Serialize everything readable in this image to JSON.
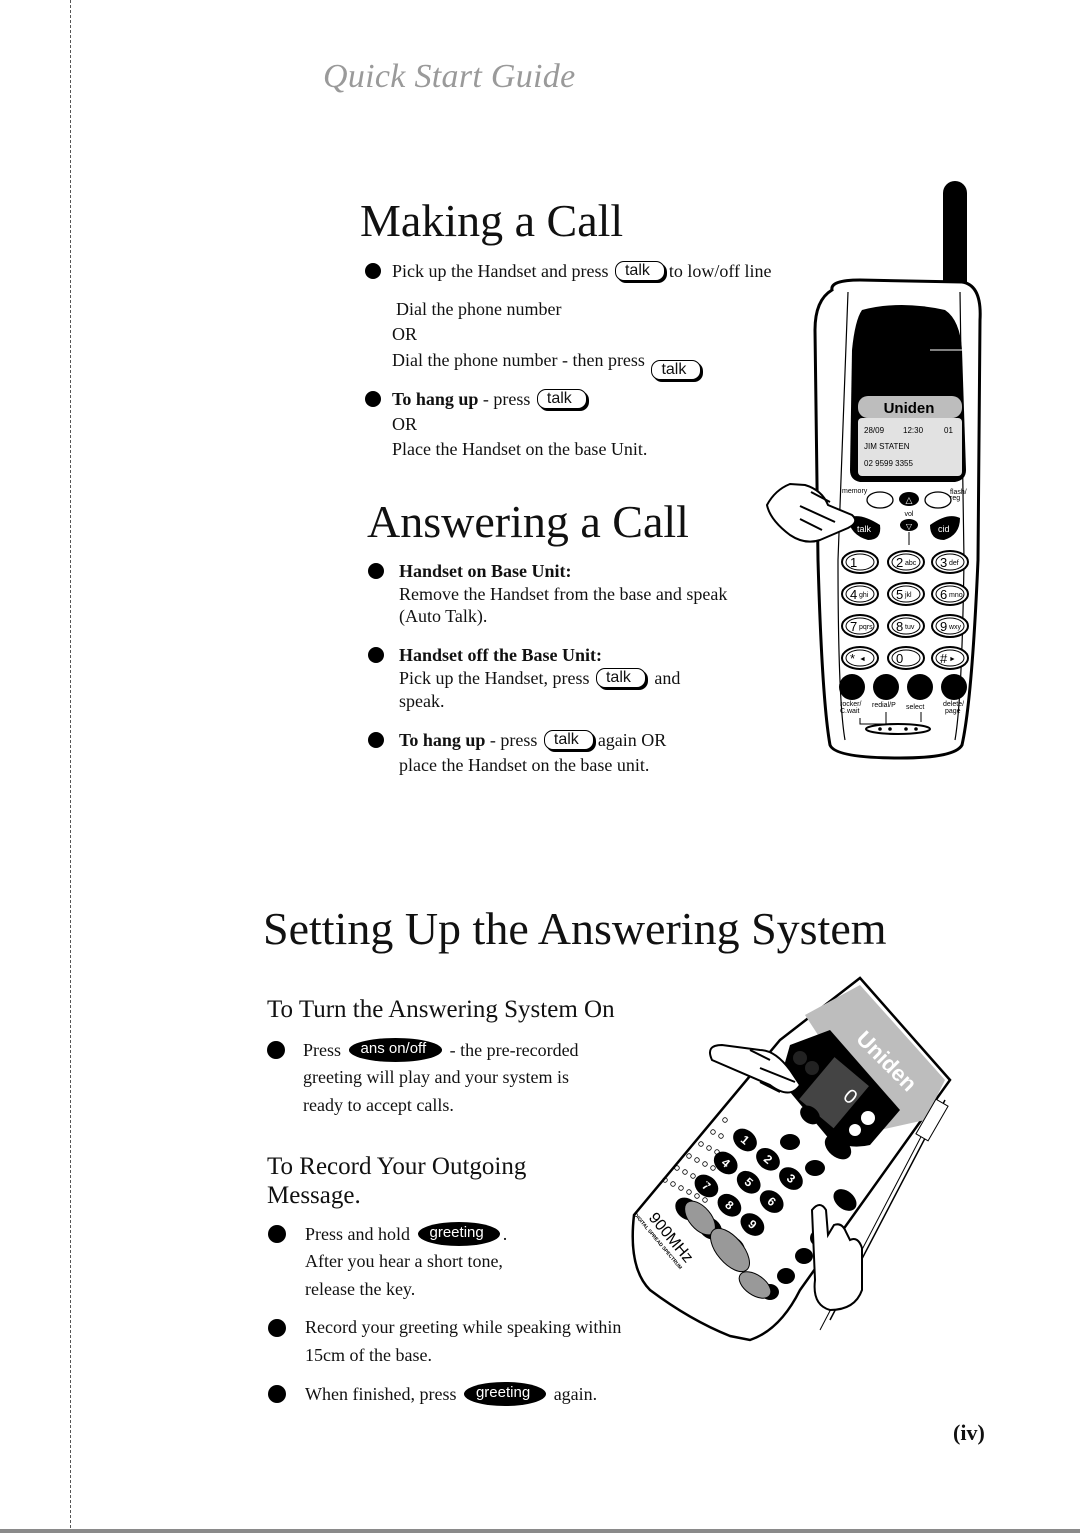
{
  "header": {
    "guide_title": "Quick Start Guide"
  },
  "making_call": {
    "title": "Making a Call",
    "step1_pre": "Pick up the Handset and press",
    "step1_post": "to low/off line",
    "dial": "Dial the phone number",
    "or1": "OR",
    "dial_then": "Dial the phone number - then press",
    "hangup_bold": "To hang up",
    "hangup_rest": " - press",
    "or2": "OR",
    "place": "Place the Handset on the base Unit."
  },
  "answering_call": {
    "title": "Answering a Call",
    "on_base_title": "Handset on Base Unit:",
    "on_base_line1": "Remove the Handset from the base and speak",
    "on_base_line2": "(Auto Talk).",
    "off_base_title": "Handset off the Base Unit:",
    "off_base_pre": "Pick up the Handset, press",
    "off_base_post": "and",
    "off_base_line2": "speak.",
    "hangup_bold": "To hang up",
    "hangup_rest": " - press",
    "hangup_post": "again OR",
    "hangup_line2": "place the Handset on the base unit."
  },
  "keys": {
    "talk": "talk",
    "ans_on_off": "ans on/off",
    "greeting": "greeting"
  },
  "answering_system": {
    "title": "Setting Up the Answering System",
    "turn_on_title": "To Turn the Answering System On",
    "turn_on_pre": "Press",
    "turn_on_post": "- the pre-recorded",
    "turn_on_line2": "greeting will play and your system is",
    "turn_on_line3": "ready to accept calls.",
    "record_title_line1": "To Record Your Outgoing",
    "record_title_line2": "Message.",
    "hold_pre": "Press and hold",
    "hold_post": ".",
    "hold_line2": "After you hear a short tone,",
    "hold_line3": "release the key.",
    "record_line1": "Record your greeting while speaking within",
    "record_line2": "15cm of the base.",
    "finished_pre": "When finished, press",
    "finished_post": "again."
  },
  "handset": {
    "brand": "Uniden",
    "display_date": "28/09",
    "display_time": "12:30",
    "display_index": "01",
    "display_name": "JIM STATEN",
    "display_number": "02 9599 3355",
    "labels": {
      "memory": "memory",
      "flash": "flash/",
      "reg": "reg",
      "vol": "vol",
      "talk": "talk",
      "cid": "cid",
      "rocker": "rocker/",
      "cwait": "C.wait",
      "redial": "redial/P",
      "select": "select",
      "delete": "delete/",
      "page": "page"
    },
    "keys": [
      {
        "num": "1",
        "sub": ""
      },
      {
        "num": "2",
        "sub": "abc"
      },
      {
        "num": "3",
        "sub": "def"
      },
      {
        "num": "4",
        "sub": "ghi"
      },
      {
        "num": "5",
        "sub": "jkl"
      },
      {
        "num": "6",
        "sub": "mno"
      },
      {
        "num": "7",
        "sub": "pqrs"
      },
      {
        "num": "8",
        "sub": "tuv"
      },
      {
        "num": "9",
        "sub": "wxy"
      },
      {
        "num": "*",
        "sub": "◄"
      },
      {
        "num": "0",
        "sub": ""
      },
      {
        "num": "#",
        "sub": "►"
      }
    ]
  },
  "base_unit": {
    "brand": "Uniden",
    "display_digit": "0",
    "band": "900MHz",
    "band_sub": "DIGITAL SPREAD SPECTRUM"
  },
  "footer": {
    "page_number": "(iv)"
  }
}
